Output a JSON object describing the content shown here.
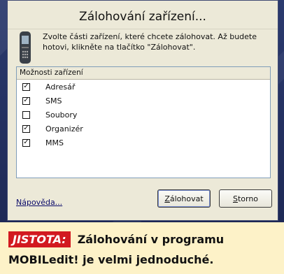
{
  "dialog": {
    "title": "Zálohování zařízení...",
    "intro": "Zvolte části zařízení, které chcete zálohovat. Až budete hotovi, klikněte na tlačítko \"Zálohovat\".",
    "list_header": "Možnosti zařízení",
    "items": [
      {
        "label": "Adresář",
        "checked": true
      },
      {
        "label": "SMS",
        "checked": true
      },
      {
        "label": "Soubory",
        "checked": false
      },
      {
        "label": "Organizér",
        "checked": true
      },
      {
        "label": "MMS",
        "checked": true
      }
    ],
    "help_link": "Nápověda...",
    "backup_button": "Zálohovat",
    "cancel_button": "Storno"
  },
  "caption": {
    "badge": "JISTOTA:",
    "line1": "Zálohování v programu",
    "line2": "MOBILedit! je velmi jednoduché."
  },
  "colors": {
    "badge": "#d21920",
    "caption_bg": "#fdf2c8",
    "dialog_bg": "#ece9d8"
  }
}
